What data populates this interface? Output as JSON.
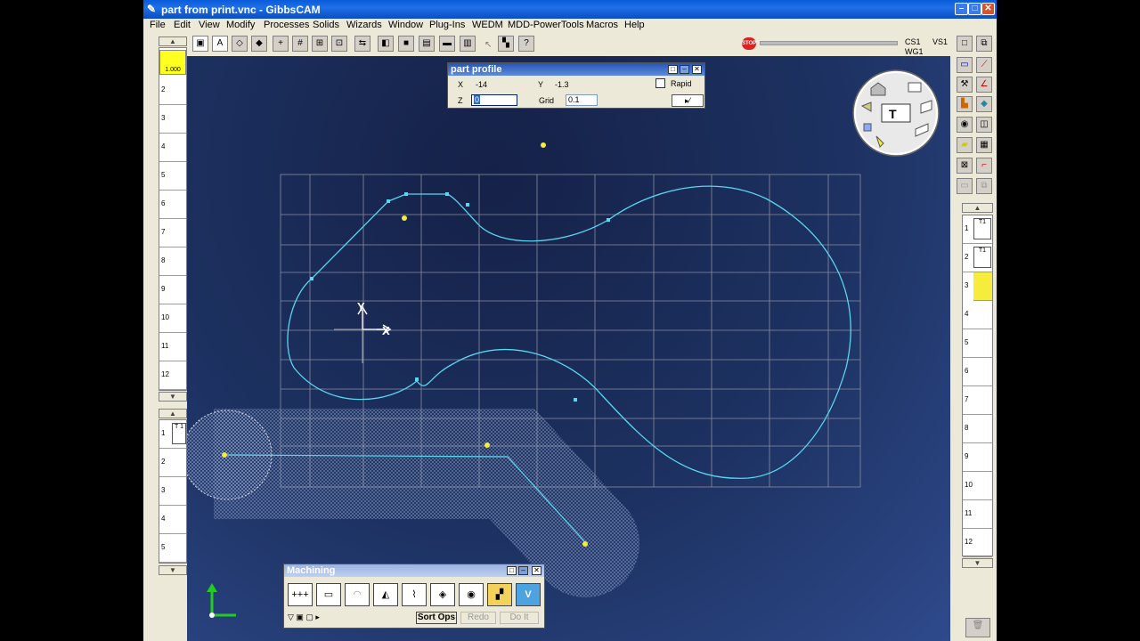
{
  "window": {
    "title": "part from print.vnc - GibbsCAM"
  },
  "menu": [
    "File",
    "Edit",
    "View",
    "Modify",
    "Processes",
    "Solids",
    "Wizards",
    "Window",
    "Plug-Ins",
    "WEDM",
    "MDD-PowerTools",
    "Macros",
    "Help"
  ],
  "status": {
    "cs1": "CS1",
    "vs1": "VS1",
    "wg1": "WG1",
    "stop": "STOP"
  },
  "left_tools": {
    "top_label": "1.000",
    "slot_numbers": [
      "2",
      "3",
      "4",
      "5",
      "6",
      "7",
      "8",
      "9",
      "10",
      "11",
      "12"
    ]
  },
  "left_ops": {
    "slot_numbers": [
      "1",
      "2",
      "3",
      "4",
      "5"
    ],
    "t1": "T 1"
  },
  "right_tools": {
    "slot_numbers": [
      "1",
      "2",
      "3",
      "4",
      "5",
      "6",
      "7",
      "8",
      "9",
      "10",
      "11",
      "12"
    ],
    "t1a": "T1",
    "t1b": "T1"
  },
  "part_profile": {
    "title": "part profile",
    "x_label": "X",
    "x_value": "-14",
    "y_label": "Y",
    "y_value": "-1.3",
    "z_label": "Z",
    "z_value": "0",
    "grid_label": "Grid",
    "grid_value": "0.1",
    "rapid_label": "Rapid"
  },
  "machining": {
    "title": "Machining",
    "sort_ops": "Sort Ops",
    "redo": "Redo",
    "do_it": "Do It"
  },
  "axis": {
    "x": "X",
    "y": "Y"
  },
  "dial": {
    "center": "T"
  },
  "colors": {
    "accent": "#1f6fe9",
    "profile": "#59d6f0",
    "highlight": "#f5ec3c"
  }
}
